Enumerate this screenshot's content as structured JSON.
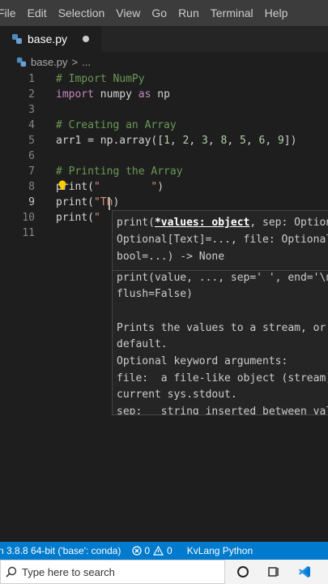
{
  "menubar": {
    "items": [
      "File",
      "Edit",
      "Selection",
      "View",
      "Go",
      "Run",
      "Terminal",
      "Help"
    ]
  },
  "tab": {
    "filename": "base.py",
    "unsaved_dot": true
  },
  "breadcrumb": {
    "file": "base.py",
    "sep": ">",
    "more": "..."
  },
  "editor": {
    "line_numbers": [
      "1",
      "2",
      "3",
      "4",
      "5",
      "6",
      "7",
      "8",
      "9",
      "10",
      "11"
    ],
    "active_line": "9",
    "lines": {
      "l1": "# Import NumPy",
      "l2_kw": "import",
      "l2_a": " numpy ",
      "l2_as": "as",
      "l2_b": " np",
      "l4": "# Creating an Array",
      "l5_a": "arr1 = np.array([",
      "l5_nums": [
        "1",
        "2",
        "3",
        "8",
        "5",
        "6",
        "9"
      ],
      "l5_end": "])",
      "l7": "# Printing the Array",
      "l8_a": "print(",
      "l8_str": "\"        \"",
      "l8_end": ")",
      "l9_a": "print(",
      "l9_str": "\"Th",
      "l9_end": ")",
      "l10_a": "print(",
      "l10_str": "\""
    }
  },
  "hover": {
    "sig_pre": "print(",
    "sig_param": "*values: object",
    "sig_post": ", sep: Option",
    "sig2": "Optional[Text]=..., file: Optional",
    "sig3": "bool=...) -> None",
    "doc1": "print(value, ..., sep=' ', end='\\n",
    "doc2": "flush=False)",
    "doc3": "Prints the values to a stream, or",
    "doc4": "default.",
    "doc5": "Optional keyword arguments:",
    "doc6": "file:  a file-like object (stream)",
    "doc7": "current sys.stdout.",
    "doc8": "sep:   string inserted between val"
  },
  "statusbar": {
    "interpreter": "n 3.8.8 64-bit ('base': conda)",
    "errors": "0",
    "warnings": "0",
    "language": "KvLang Python"
  },
  "taskbar": {
    "search_placeholder": "Type here to search"
  },
  "colors": {
    "statusbar": "#007acc",
    "comment": "#6a9955",
    "keyword": "#c586c0",
    "string": "#ce9178",
    "number": "#b5cea8"
  }
}
